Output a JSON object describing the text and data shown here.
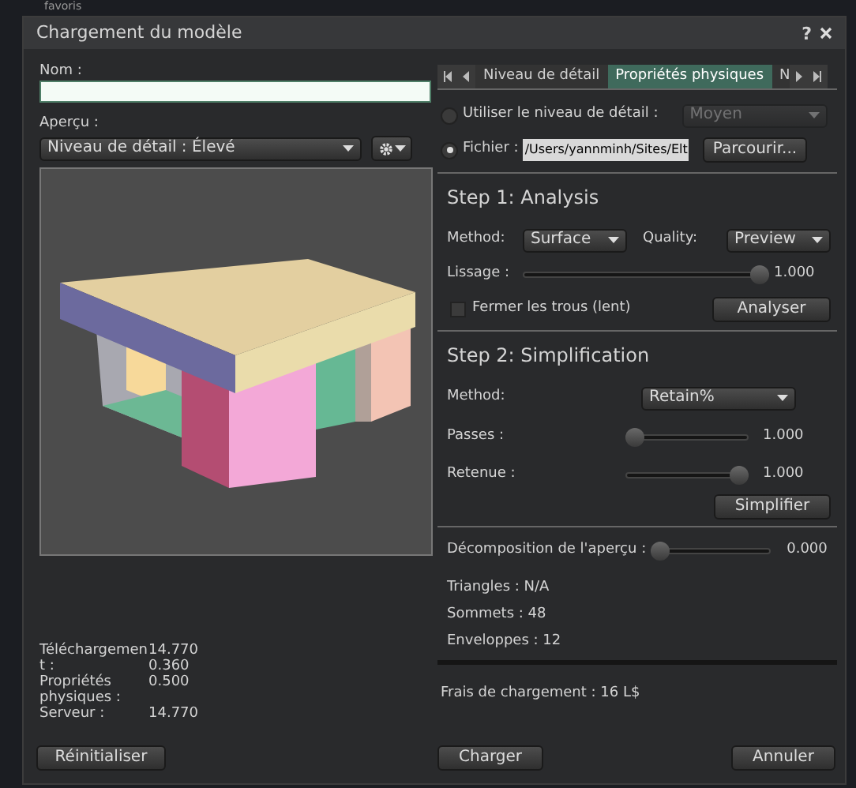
{
  "background_label": "favoris",
  "window": {
    "title": "Chargement du modèle",
    "help": "?"
  },
  "name": {
    "label": "Nom :"
  },
  "preview": {
    "label": "Aperçu :",
    "lod": "Niveau de détail : Élevé"
  },
  "stats": [
    {
      "label": "Téléchargement :",
      "values": [
        "14.770",
        "0.360"
      ]
    },
    {
      "label": "Propriétés physiques :",
      "values": [
        "0.500"
      ]
    },
    {
      "label": "Serveur :",
      "values": [
        "14.770"
      ]
    }
  ],
  "tabs": [
    {
      "label": "Niveau de détail",
      "selected": false
    },
    {
      "label": "Propriétés physiques",
      "selected": true
    },
    {
      "label": "N",
      "selected": false
    }
  ],
  "source": [
    {
      "label": "Utiliser le niveau de détail :",
      "selected": false,
      "kind": "dropdown",
      "value": "Moyen",
      "disabled": true
    },
    {
      "label": "Fichier :",
      "selected": true,
      "kind": "file",
      "value": "/Users/yannminh/Sites/Elt",
      "button": "Parcourir..."
    }
  ],
  "step1": {
    "title": "Step 1: Analysis",
    "method_label": "Method:",
    "method": "Surface",
    "quality_label": "Quality:",
    "quality": "Preview",
    "smoothing": {
      "label": "Lissage :",
      "level": 1,
      "reading": "1.000"
    },
    "close_holes": {
      "label": "Fermer les trous (lent)",
      "checked": false
    },
    "button": "Analyser"
  },
  "step2": {
    "title": "Step 2: Simplification",
    "method_label": "Method:",
    "method": "Retain%",
    "sliders": [
      {
        "label": "Passes :",
        "level": 0,
        "reading": "1.000"
      },
      {
        "label": "Retenue :",
        "level": 1,
        "reading": "1.000"
      }
    ],
    "button": "Simplifier"
  },
  "decomposition": {
    "label": "Décomposition de l'aperçu :",
    "level": 0,
    "reading": "0.000"
  },
  "info": [
    "Triangles : N/A",
    "Sommets : 48",
    "Enveloppes : 12"
  ],
  "fee": "Frais de chargement : 16 L$",
  "buttons": {
    "reset": "Réinitialiser",
    "upload": "Charger",
    "cancel": "Annuler"
  }
}
